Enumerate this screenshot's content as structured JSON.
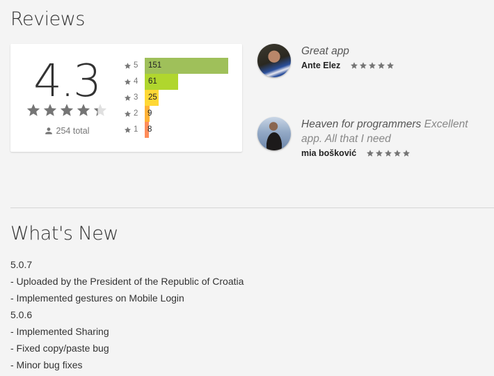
{
  "reviews": {
    "title": "Reviews",
    "rating": {
      "score": "4.3",
      "stars_value": 4.3,
      "stars_max": 5,
      "total_label": "254 total",
      "total_icon": "person-icon"
    },
    "histogram": {
      "max_count": 151,
      "rows": [
        {
          "stars": "5",
          "count": 151,
          "count_label": "151",
          "color": "#9fc05a"
        },
        {
          "stars": "4",
          "count": 61,
          "count_label": "61",
          "color": "#b0d62e"
        },
        {
          "stars": "3",
          "count": 25,
          "count_label": "25",
          "color": "#ffd835"
        },
        {
          "stars": "2",
          "count": 9,
          "count_label": "9",
          "color": "#ffb235"
        },
        {
          "stars": "1",
          "count": 8,
          "count_label": "8",
          "color": "#ff8c5a"
        }
      ]
    },
    "items": [
      {
        "title": "Great app",
        "body": "",
        "author": "Ante Elez",
        "rating": 5
      },
      {
        "title": "Heaven for programmers",
        "body": "Excellent app. All that I need",
        "author": "mia bošković",
        "rating": 5
      }
    ]
  },
  "whats_new": {
    "title": "What's New",
    "lines": [
      "5.0.7",
      "- Uploaded by the President of the Republic of Croatia",
      "- Implemented gestures on Mobile Login",
      "5.0.6",
      "- Implemented Sharing",
      "- Fixed copy/paste bug",
      "- Minor bug fixes"
    ]
  },
  "colors": {
    "star_filled": "#757575",
    "star_empty": "#e0e0e0",
    "background": "#f4f4f4"
  }
}
